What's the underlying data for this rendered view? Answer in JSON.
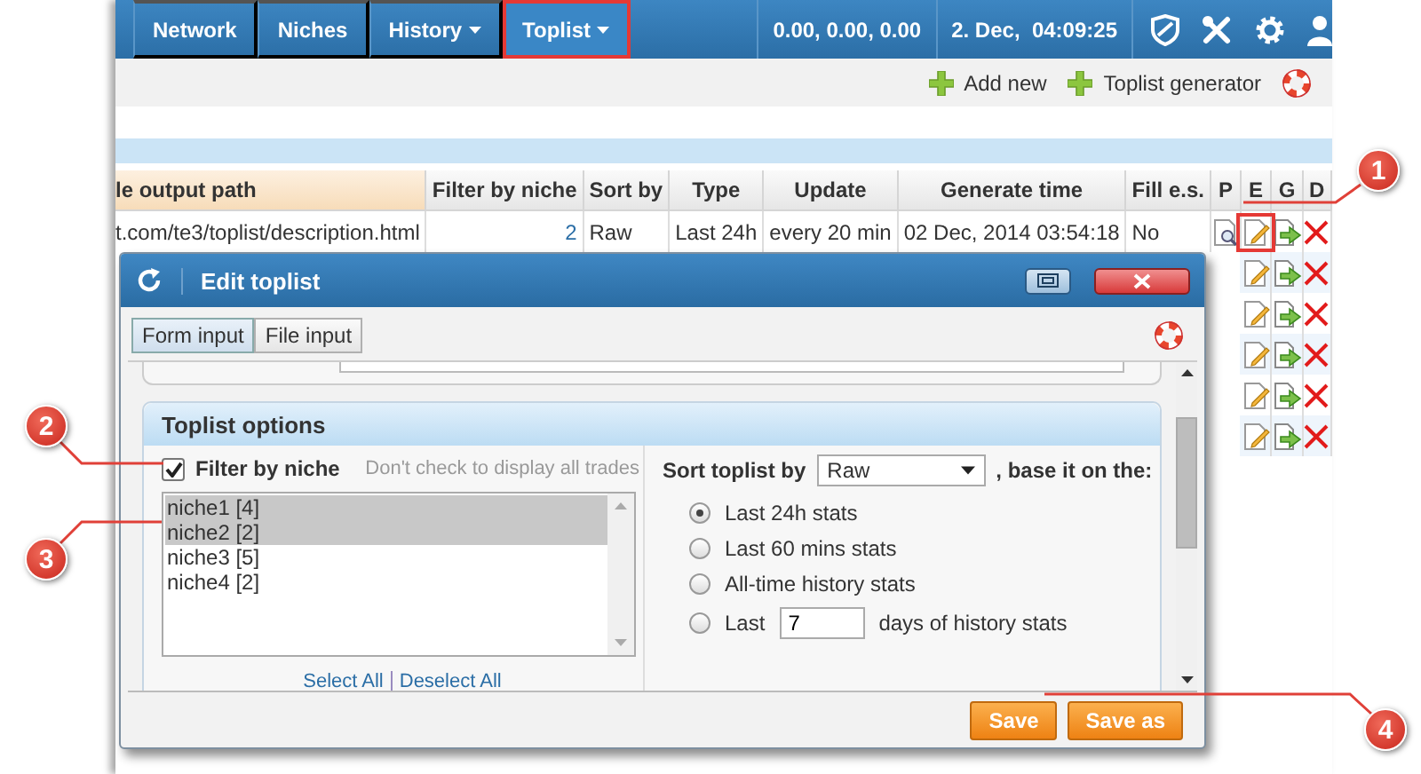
{
  "nav": {
    "items": [
      {
        "label": "Network",
        "dropdown": false,
        "highlighted": false
      },
      {
        "label": "Niches",
        "dropdown": false,
        "highlighted": false
      },
      {
        "label": "History",
        "dropdown": true,
        "highlighted": false
      },
      {
        "label": "Toplist",
        "dropdown": true,
        "highlighted": true
      }
    ],
    "stats": "0.00, 0.00, 0.00",
    "datetime": "2. Dec,  04:09:25"
  },
  "toolbar": {
    "buttons": [
      "Add new",
      "Toplist generator"
    ]
  },
  "table": {
    "columns": [
      "le output path",
      "Filter by niche",
      "Sort by",
      "Type",
      "Update",
      "Generate time",
      "Fill e.s.",
      "P",
      "E",
      "G",
      "D"
    ],
    "rows": [
      {
        "kind": "full",
        "cells": [
          "t.com/te3/toplist/description.html",
          "2",
          "Raw",
          "Last 24h",
          "every 20 min",
          "02 Dec, 2014 03:54:18",
          "No"
        ],
        "highlighted_edit": true
      },
      {
        "kind": "covered"
      },
      {
        "kind": "covered"
      },
      {
        "kind": "covered"
      },
      {
        "kind": "covered"
      },
      {
        "kind": "covered"
      }
    ]
  },
  "dialog": {
    "title": "Edit toplist",
    "tabs": [
      {
        "label": "Form input",
        "selected": true
      },
      {
        "label": "File input",
        "selected": false
      }
    ],
    "section": {
      "title": "Toplist options",
      "filter": {
        "label": "Filter by niche",
        "checked": true,
        "hint": "Don't check to display all trades"
      },
      "niches": [
        {
          "label": "niche1 [4]",
          "selected": true
        },
        {
          "label": "niche2 [2]",
          "selected": true
        },
        {
          "label": "niche3 [5]",
          "selected": false
        },
        {
          "label": "niche4 [2]",
          "selected": false
        }
      ],
      "select_all": "Select All",
      "deselect_all": "Deselect All",
      "sort_label": "Sort toplist by",
      "sort_value": "Raw",
      "base_label": ", base it on the:",
      "options": [
        {
          "kind": "plain",
          "label": "Last 24h stats",
          "selected": true
        },
        {
          "kind": "plain",
          "label": "Last 60 mins stats",
          "selected": false
        },
        {
          "kind": "plain",
          "label": "All-time history stats",
          "selected": false
        },
        {
          "kind": "days",
          "label": "Last",
          "value": "7",
          "suffix": "days of history stats",
          "selected": false
        }
      ]
    },
    "buttons": [
      "Save",
      "Save as"
    ]
  },
  "callouts": [
    "1",
    "2",
    "3",
    "4"
  ]
}
